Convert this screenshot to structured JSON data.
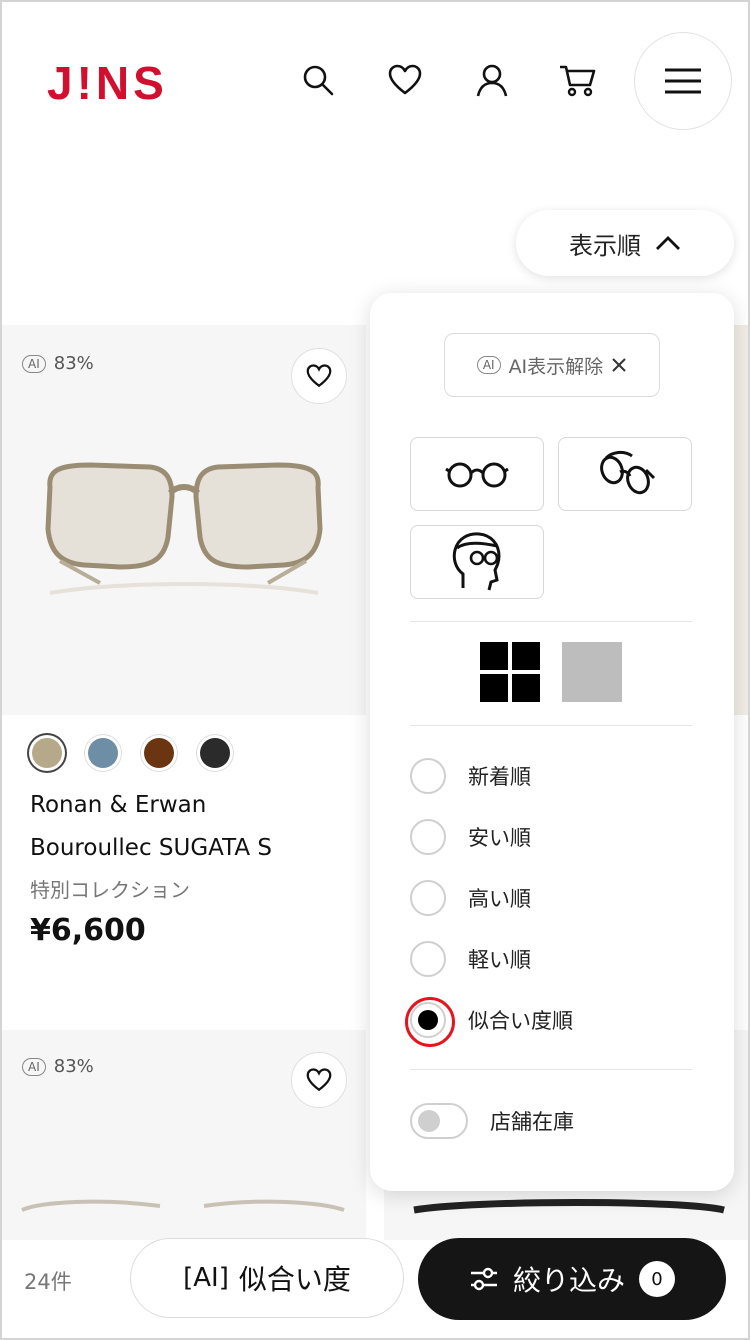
{
  "header": {
    "logo": "J!NS",
    "icons": [
      "search-icon",
      "heart-icon",
      "user-icon",
      "cart-icon",
      "menu-icon"
    ]
  },
  "sort_button": {
    "label": "表示順"
  },
  "products": [
    {
      "ai_label": "AI",
      "ai_score": "83%",
      "name_line1": "Ronan & Erwan",
      "name_line2": "Bouroullec SUGATA S",
      "collection": "特別コレクション",
      "price": "¥6,600",
      "swatches": [
        "#b5a98a",
        "#6e8ea6",
        "#6b3512",
        "#2b2b2b"
      ]
    },
    {
      "ai_label": "AI",
      "ai_score": "83%"
    }
  ],
  "panel": {
    "ai_chip_icon_label": "AI",
    "ai_chip": "AI表示解除",
    "sort_options": [
      {
        "label": "新着順",
        "selected": false
      },
      {
        "label": "安い順",
        "selected": false
      },
      {
        "label": "高い順",
        "selected": false
      },
      {
        "label": "軽い順",
        "selected": false
      },
      {
        "label": "似合い度順",
        "selected": true
      }
    ],
    "store_stock_label": "店舗在庫"
  },
  "bottom_bar": {
    "count": "24件",
    "ai_fit_prefix": "AI",
    "ai_fit_label": "似合い度",
    "filter_label": "絞り込み",
    "filter_count": "0"
  },
  "colors": {
    "brand": "#d10f2e",
    "highlight": "#e4151d",
    "dark": "#151515"
  }
}
